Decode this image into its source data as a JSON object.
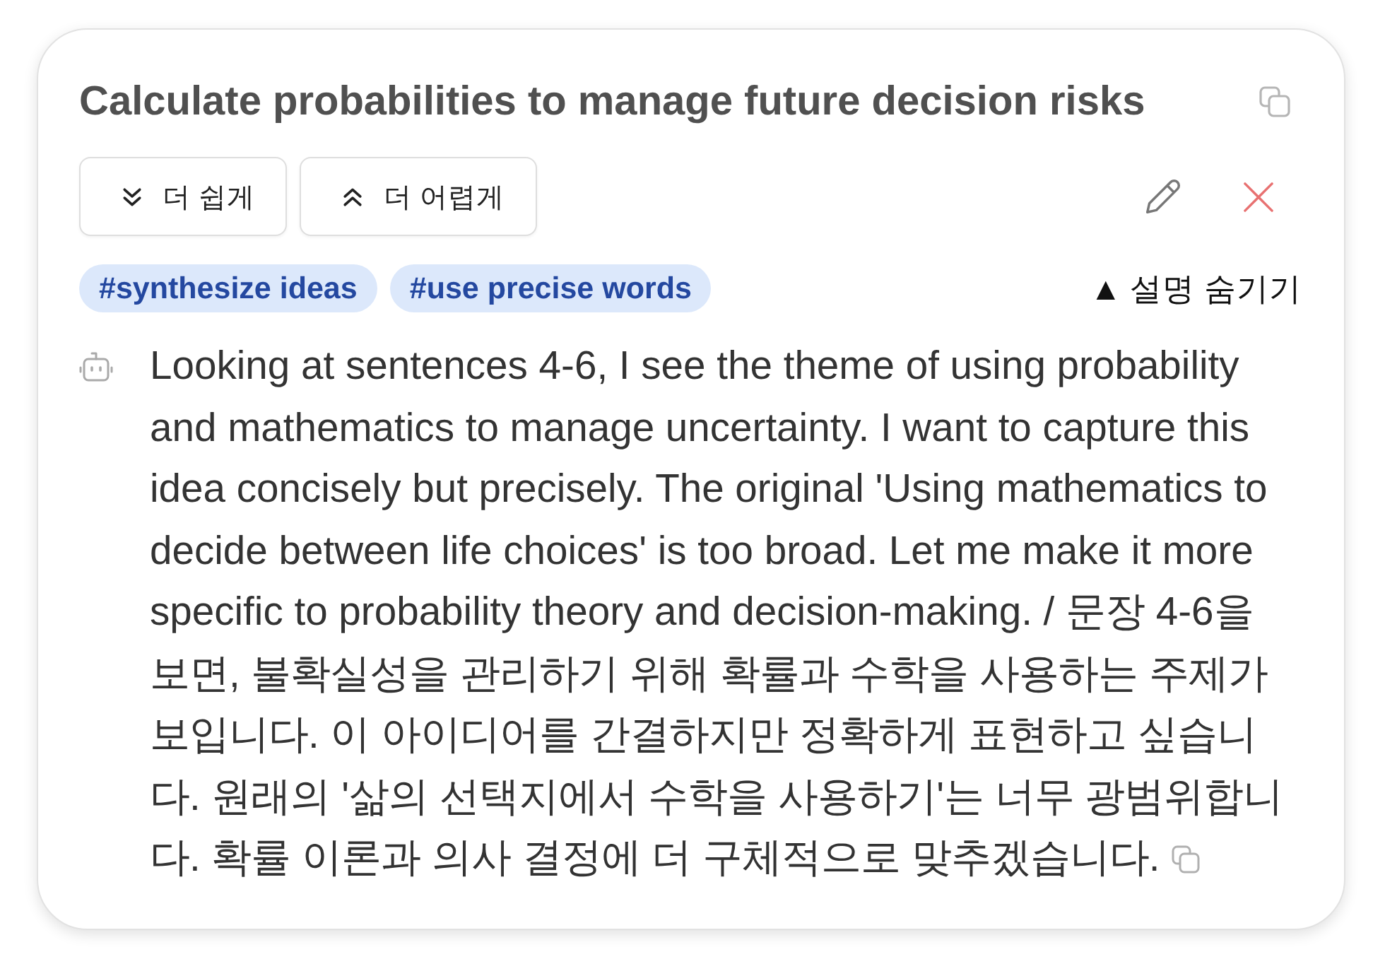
{
  "card": {
    "title": "Calculate probabilities to manage future decision risks",
    "buttons": [
      {
        "kind": "easier",
        "label": "더 쉽게"
      },
      {
        "kind": "harder",
        "label": "더 어렵게"
      }
    ],
    "tags": [
      "#synthesize ideas",
      "#use precise words"
    ],
    "explanation_toggle": {
      "label": "▲ 설명 숨기기",
      "expanded": true
    },
    "explanation": {
      "text": "Looking at sentences 4-6, I see the theme of using probability and mathematics to manage uncertainty. I want to capture this idea concisely but precisely. The original 'Using mathematics to decide between life choices' is too broad. Let me make it more specific to probability theory and decision-making. / 문장 4-6을 보면, 불확실성을 관리하기 위해 확률과 수학을 사용하는 주제가 보입니다. 이 아이디어를 간결하지만 정확하게 표현하고 싶습니다. 원래의 '삶의 선택지에서 수학을 사용하기'는 너무 광범위합니다. 확률 이론과 의사 결정에 더 구체적으로 맞추겠습니다."
    }
  }
}
